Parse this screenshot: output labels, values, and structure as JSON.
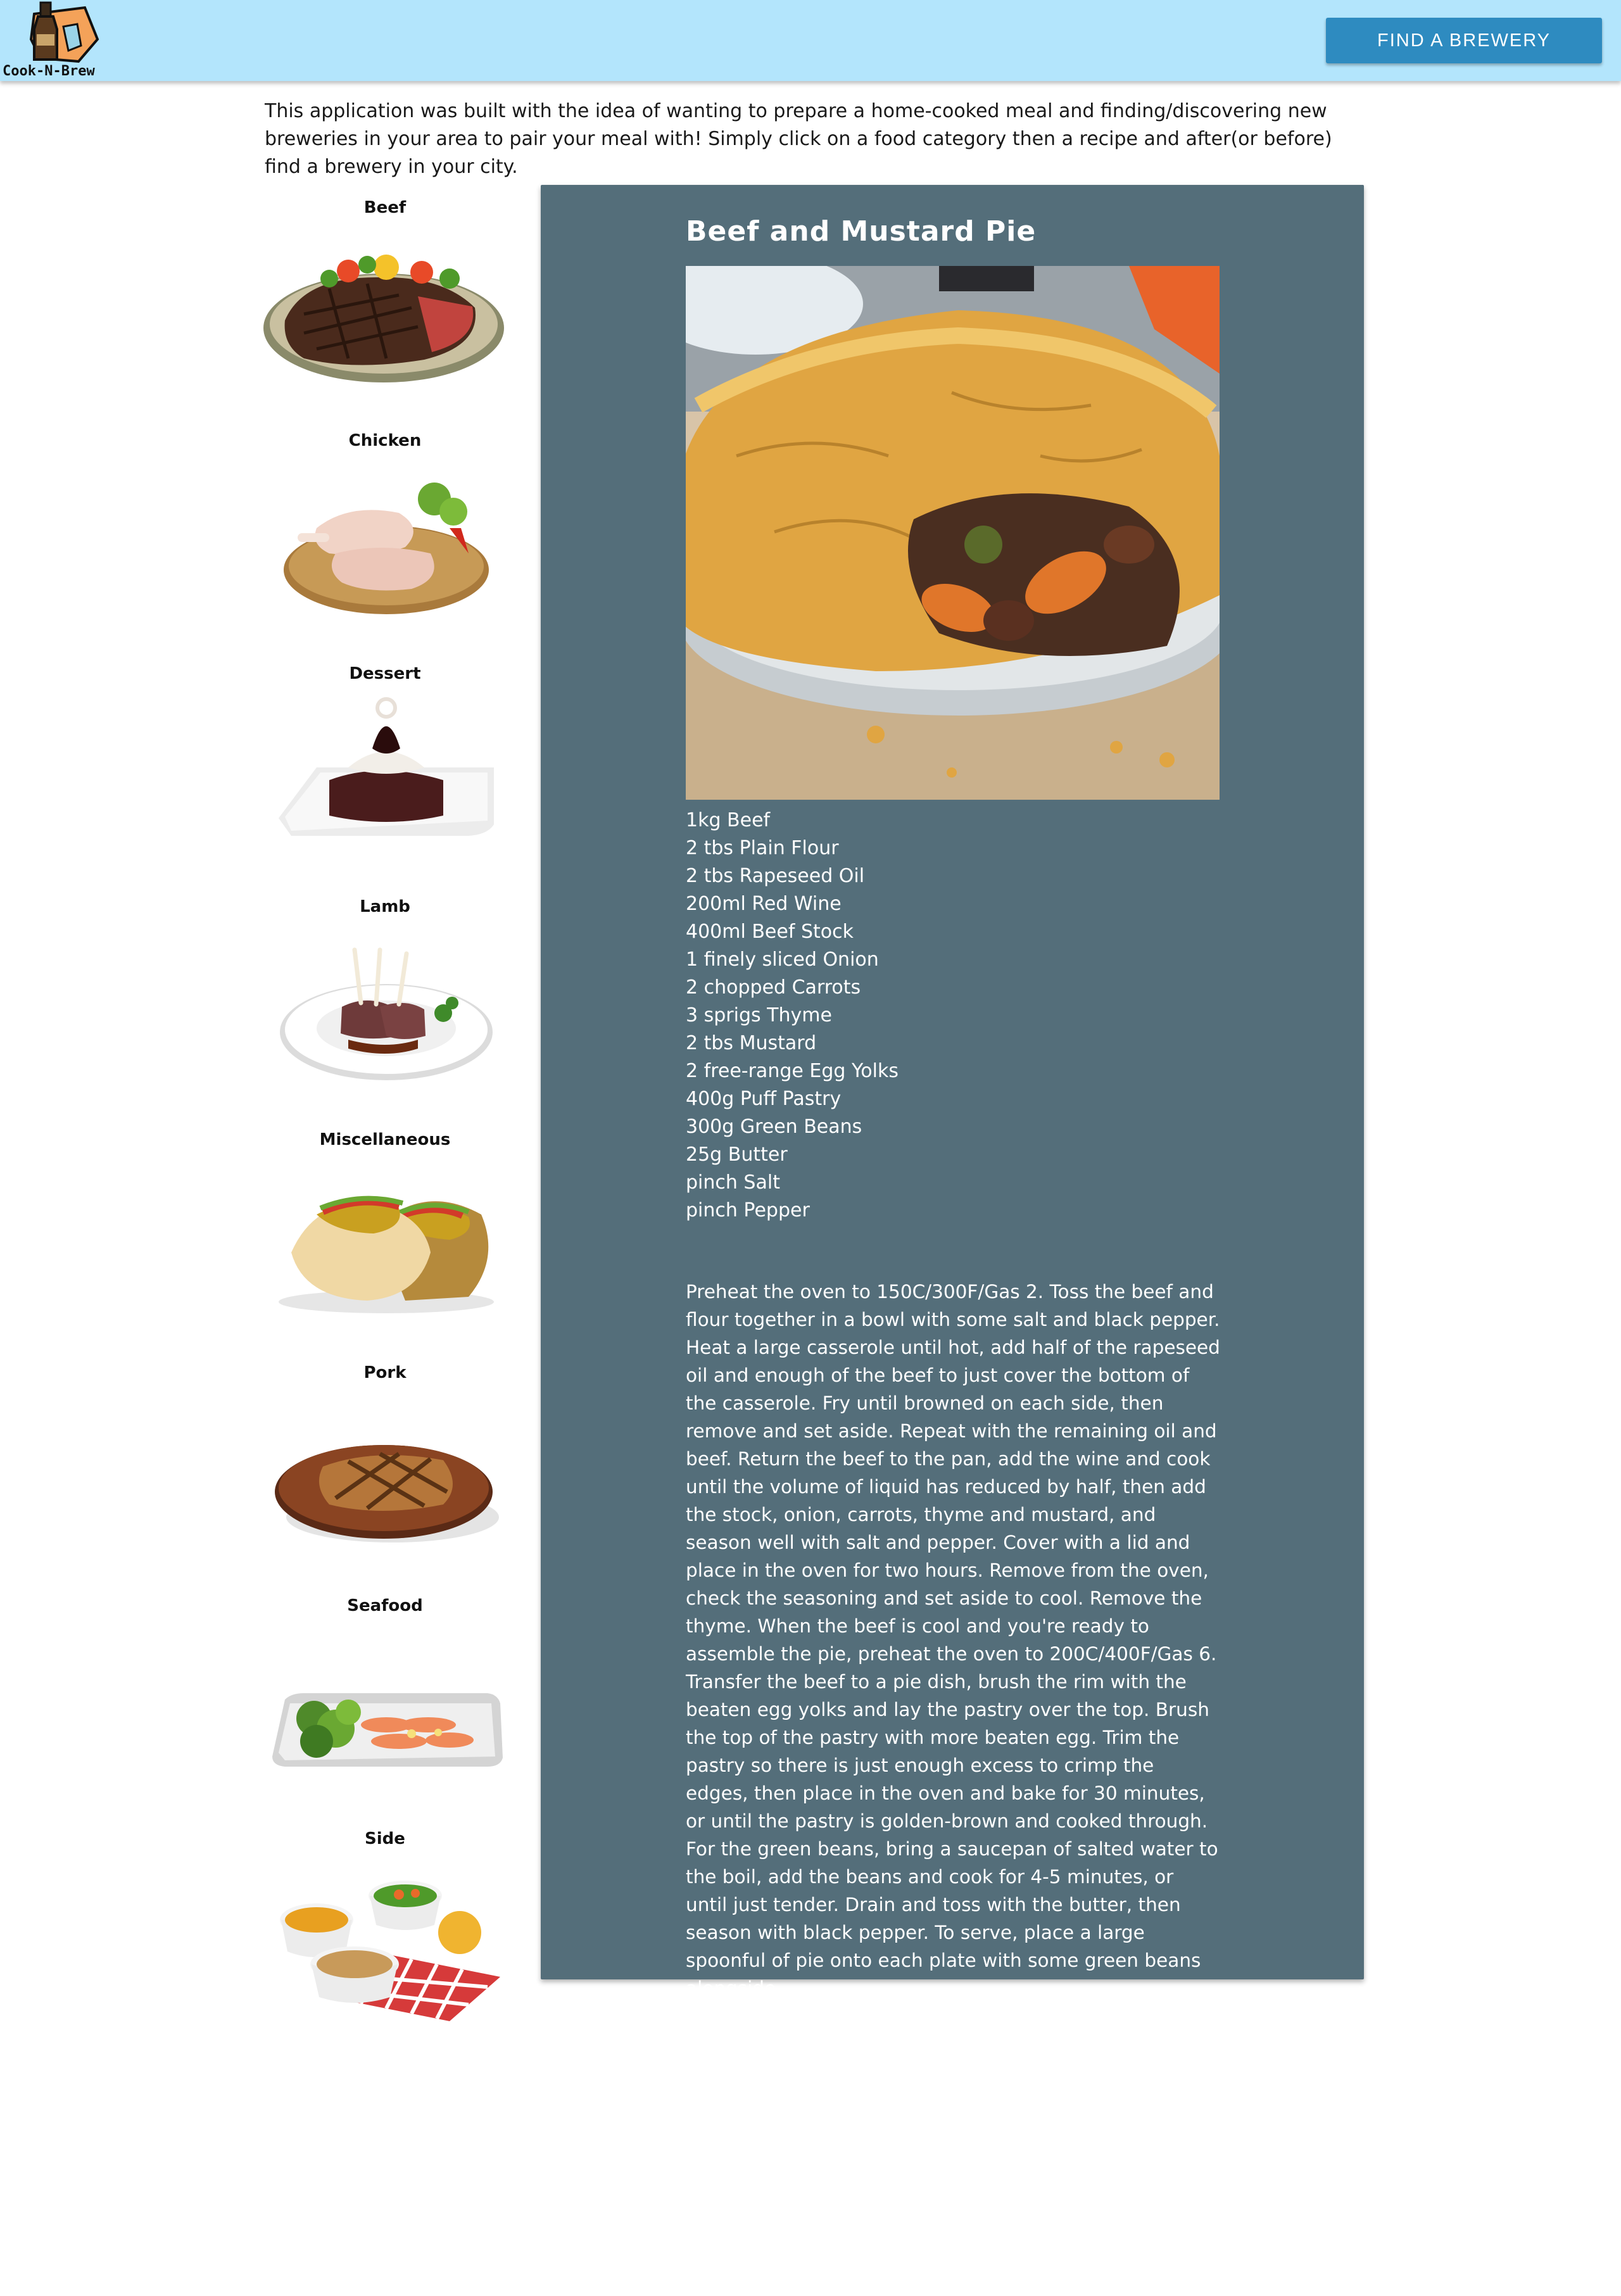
{
  "header": {
    "logo_text": "Cook-N-Brew",
    "find_brewery_label": "FIND A BREWERY"
  },
  "intro": "This application was built with the idea of wanting to prepare a home-cooked meal and finding/discovering new breweries in your area to pair your meal with! Simply click on a food category then a recipe and after(or before) find a brewery in your city.",
  "categories": [
    {
      "label": "Beef"
    },
    {
      "label": "Chicken"
    },
    {
      "label": "Dessert"
    },
    {
      "label": "Lamb"
    },
    {
      "label": "Miscellaneous"
    },
    {
      "label": "Pork"
    },
    {
      "label": "Seafood"
    },
    {
      "label": "Side"
    }
  ],
  "recipe": {
    "title": "Beef and Mustard Pie",
    "ingredients": [
      "1kg Beef",
      "2 tbs Plain Flour",
      "2 tbs Rapeseed Oil",
      "200ml Red Wine",
      "400ml Beef Stock",
      "1 finely sliced Onion",
      "2 chopped Carrots",
      "3 sprigs Thyme",
      "2 tbs Mustard",
      "2 free-range Egg Yolks",
      "400g Puff Pastry",
      "300g Green Beans",
      "25g Butter",
      "pinch Salt",
      "pinch Pepper"
    ],
    "instructions": "Preheat the oven to 150C/300F/Gas 2. Toss the beef and flour together in a bowl with some salt and black pepper. Heat a large casserole until hot, add half of the rapeseed oil and enough of the beef to just cover the bottom of the casserole. Fry until browned on each side, then remove and set aside. Repeat with the remaining oil and beef. Return the beef to the pan, add the wine and cook until the volume of liquid has reduced by half, then add the stock, onion, carrots, thyme and mustard, and season well with salt and pepper. Cover with a lid and place in the oven for two hours. Remove from the oven, check the seasoning and set aside to cool. Remove the thyme. When the beef is cool and you're ready to assemble the pie, preheat the oven to 200C/400F/Gas 6. Transfer the beef to a pie dish, brush the rim with the beaten egg yolks and lay the pastry over the top. Brush the top of the pastry with more beaten egg. Trim the pastry so there is just enough excess to crimp the edges, then place in the oven and bake for 30 minutes, or until the pastry is golden-brown and cooked through. For the green beans, bring a saucepan of salted water to the boil, add the beans and cook for 4-5 minutes, or until just tender. Drain and toss with the butter, then season with black pepper. To serve, place a large spoonful of pie onto each plate with some green beans alongside."
  },
  "colors": {
    "navbar": "#b3e5fc",
    "button": "#2e8bc0",
    "card": "#546e7a"
  }
}
